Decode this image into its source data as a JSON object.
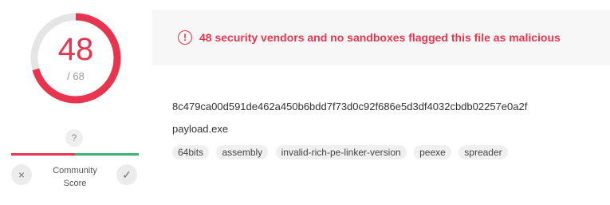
{
  "detection": {
    "positives": "48",
    "total": "/ 68",
    "ratio": 0.706,
    "colors": {
      "accent": "#e8344e",
      "track": "#e5e5e5"
    }
  },
  "community": {
    "badge": "?",
    "label_line1": "Community",
    "label_line2": "Score",
    "down_icon": "×",
    "up_icon": "✓",
    "colors": {
      "negative": "#e8344e",
      "positive": "#3bb273"
    }
  },
  "alert": {
    "icon": "!",
    "text": "48 security vendors and no sandboxes flagged this file as malicious"
  },
  "file": {
    "hash": "8c479ca00d591de462a450b6bdd7f73d0c92f686e5d3df4032cbdb02257e0a2f",
    "name": "payload.exe",
    "tags": [
      "64bits",
      "assembly",
      "invalid-rich-pe-linker-version",
      "peexe",
      "spreader"
    ]
  }
}
